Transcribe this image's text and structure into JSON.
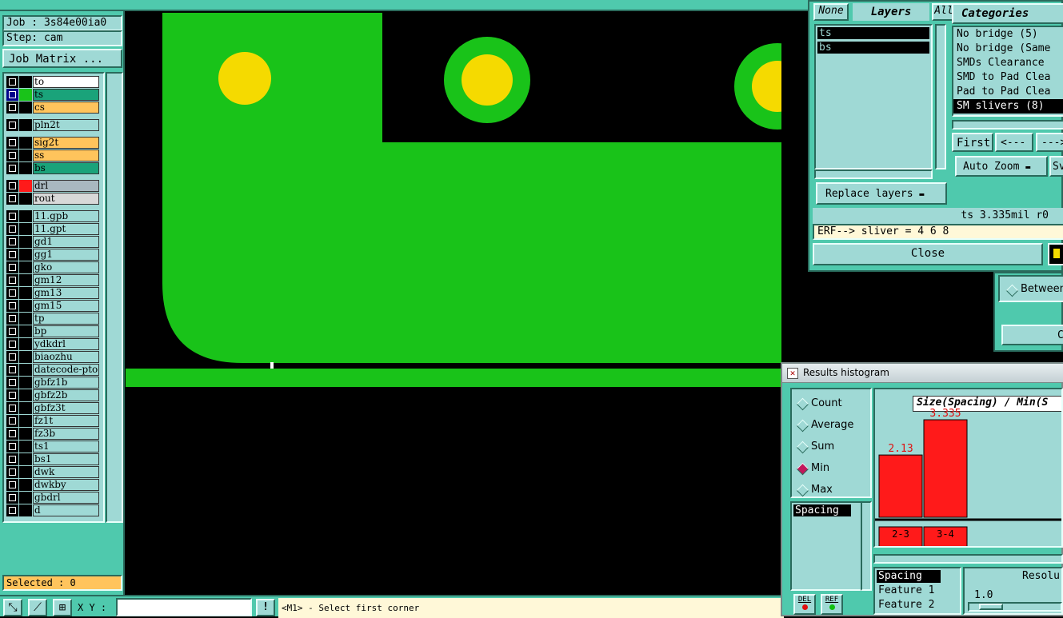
{
  "job": {
    "job_label": "Job : 3s84e00ia0",
    "step_label": "Step: cam",
    "matrix_button": "Job Matrix ..."
  },
  "layers": [
    {
      "name": "to",
      "color": "#ffffff",
      "swatch": "#000000"
    },
    {
      "name": "ts",
      "color": "#1aa37a",
      "swatch": "#19c319"
    },
    {
      "name": "cs",
      "color": "#ffc45c",
      "swatch": "#000000"
    },
    {
      "name": "pln2t",
      "color": "#9fd9d5",
      "swatch": "#000000"
    },
    {
      "name": "sig2t",
      "color": "#ffc45c",
      "swatch": "#000000"
    },
    {
      "name": "ss",
      "color": "#ffc45c",
      "swatch": "#000000"
    },
    {
      "name": "bs",
      "color": "#1aa37a",
      "swatch": "#000000"
    },
    {
      "name": "drl",
      "color": "#a9b8c0",
      "swatch": "#ff1a1a"
    },
    {
      "name": "rout",
      "color": "#d8d8d8",
      "swatch": "#000000"
    },
    {
      "name": "11.gpb",
      "color": "#9fd9d5",
      "swatch": "#000000"
    },
    {
      "name": "11.gpt",
      "color": "#9fd9d5",
      "swatch": "#000000"
    },
    {
      "name": "gd1",
      "color": "#9fd9d5",
      "swatch": "#000000"
    },
    {
      "name": "gg1",
      "color": "#9fd9d5",
      "swatch": "#000000"
    },
    {
      "name": "gko",
      "color": "#9fd9d5",
      "swatch": "#000000"
    },
    {
      "name": "gm12",
      "color": "#9fd9d5",
      "swatch": "#000000"
    },
    {
      "name": "gm13",
      "color": "#9fd9d5",
      "swatch": "#000000"
    },
    {
      "name": "gm15",
      "color": "#9fd9d5",
      "swatch": "#000000"
    },
    {
      "name": "tp",
      "color": "#9fd9d5",
      "swatch": "#000000"
    },
    {
      "name": "bp",
      "color": "#9fd9d5",
      "swatch": "#000000"
    },
    {
      "name": "ydkdrl",
      "color": "#9fd9d5",
      "swatch": "#000000"
    },
    {
      "name": "biaozhu",
      "color": "#9fd9d5",
      "swatch": "#000000"
    },
    {
      "name": "datecode-pto",
      "color": "#9fd9d5",
      "swatch": "#000000"
    },
    {
      "name": "gbfz1b",
      "color": "#9fd9d5",
      "swatch": "#000000"
    },
    {
      "name": "gbfz2b",
      "color": "#9fd9d5",
      "swatch": "#000000"
    },
    {
      "name": "gbfz3t",
      "color": "#9fd9d5",
      "swatch": "#000000"
    },
    {
      "name": "fz1t",
      "color": "#9fd9d5",
      "swatch": "#000000"
    },
    {
      "name": "fz3b",
      "color": "#9fd9d5",
      "swatch": "#000000"
    },
    {
      "name": "ts1",
      "color": "#9fd9d5",
      "swatch": "#000000"
    },
    {
      "name": "bs1",
      "color": "#9fd9d5",
      "swatch": "#000000"
    },
    {
      "name": "dwk",
      "color": "#9fd9d5",
      "swatch": "#000000"
    },
    {
      "name": "dwkby",
      "color": "#9fd9d5",
      "swatch": "#000000"
    },
    {
      "name": "gbdrl",
      "color": "#9fd9d5",
      "swatch": "#000000"
    },
    {
      "name": "d",
      "color": "#9fd9d5",
      "swatch": "#000000"
    }
  ],
  "selected_label": "Selected : 0",
  "bottom_bar": {
    "xy_label": "X Y :",
    "xy_value": "",
    "exclaim": "!",
    "prompt": "<M1> - Select first corner"
  },
  "layers_panel": {
    "none_btn": "None",
    "layers_title": "Layers",
    "all_btn": "All",
    "items": [
      "ts",
      "bs"
    ],
    "replace_btn": "Replace layers"
  },
  "categories_panel": {
    "title": "Categories",
    "items": [
      "No bridge (5)",
      "No bridge (Same",
      "SMDs Clearance",
      "SMD to Pad Clea",
      "Pad to Pad Clea",
      "SM slivers (8)"
    ],
    "selected_index": 5,
    "first_btn": "First",
    "prev_btn": "<---",
    "next_btn": "--->",
    "auto_zoom_btn": "Auto Zoom",
    "sv_btn": "Sv"
  },
  "status_line": "ts 3.335mil  r0",
  "erf_line": "ERF--> sliver = 4 6 8",
  "close_btn": "Close",
  "between_label": "Between",
  "cl_btn": "Cl",
  "histogram": {
    "window_title": "Results histogram",
    "modes": [
      {
        "label": "Count",
        "on": false
      },
      {
        "label": "Average",
        "on": false
      },
      {
        "label": "Sum",
        "on": false
      },
      {
        "label": "Min",
        "on": true
      },
      {
        "label": "Max",
        "on": false
      }
    ],
    "list_item": "Spacing",
    "chart_title": "Size(Spacing) / Min(S",
    "del_btn": "DEL",
    "ref_btn": "REF",
    "fields": [
      "Spacing",
      "Feature 1",
      "Feature 2"
    ],
    "resolution_label": "Resolu",
    "resolution_value": "1.0"
  },
  "chart_data": {
    "type": "bar",
    "title": "Size(Spacing) / Min(S",
    "categories": [
      "2-3",
      "3-4"
    ],
    "values": [
      2.13,
      3.335
    ],
    "value_labels": [
      "2.13",
      "3.335"
    ],
    "ylim": [
      0,
      3.5
    ],
    "color": "#ff1a1a"
  }
}
